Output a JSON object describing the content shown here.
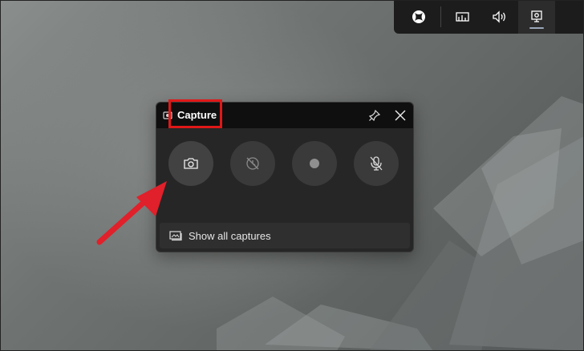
{
  "capture_widget": {
    "title": "Capture",
    "footer_label": "Show all captures",
    "buttons": [
      {
        "icon": "camera-icon",
        "enabled": true
      },
      {
        "icon": "record-last-icon",
        "enabled": false
      },
      {
        "icon": "record-icon",
        "enabled": false
      },
      {
        "icon": "mic-off-icon",
        "enabled": true
      }
    ]
  },
  "game_bar": {
    "items": [
      "xbox-icon",
      "performance-icon",
      "audio-icon",
      "capture-icon"
    ],
    "active": "capture-icon"
  },
  "colors": {
    "highlight": "#e01818",
    "arrow": "#e0202a",
    "widget_bg": "#262626",
    "header_bg": "#0f0f0f"
  }
}
